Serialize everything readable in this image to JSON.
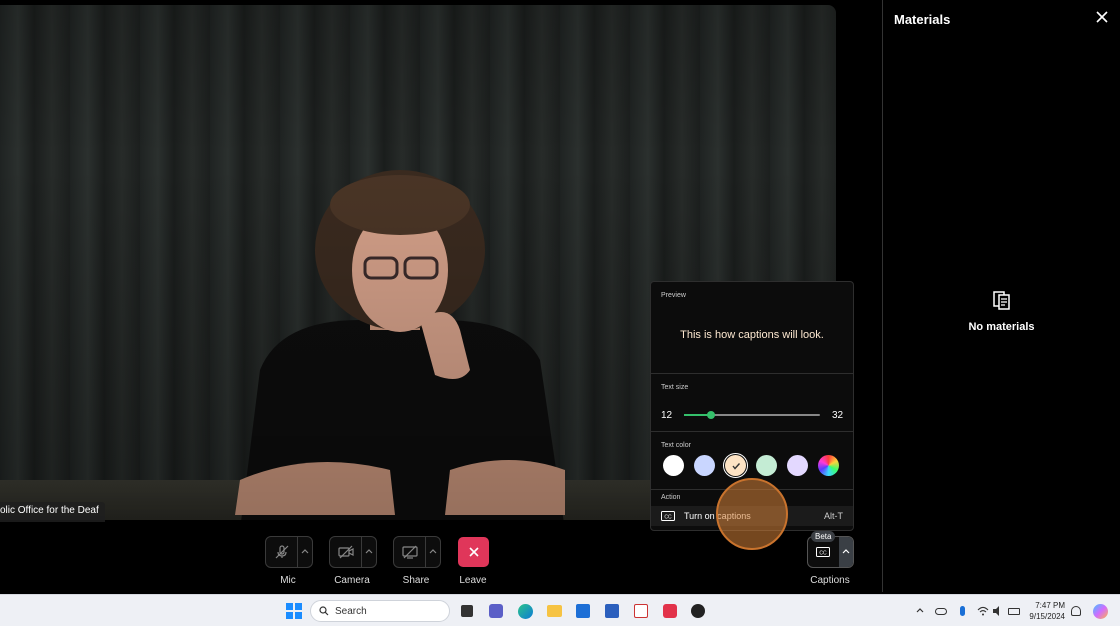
{
  "video": {
    "participant_name": "olic Office for the Deaf"
  },
  "materials": {
    "title": "Materials",
    "empty_label": "No materials"
  },
  "toolbar": {
    "mic_label": "Mic",
    "camera_label": "Camera",
    "share_label": "Share",
    "leave_label": "Leave",
    "captions_label": "Captions",
    "beta_badge": "Beta",
    "leave_color": "#e0365a"
  },
  "captions_popup": {
    "preview_label": "Preview",
    "preview_text": "This is how captions will look.",
    "text_size_label": "Text size",
    "size_min": "12",
    "size_max": "32",
    "size_value_fraction": 0.2,
    "text_color_label": "Text color",
    "colors": [
      "#ffffff",
      "#c9d6ff",
      "#fde3c4",
      "#c4ecd4",
      "#e3d8ff",
      "rainbow"
    ],
    "selected_color_index": 2,
    "action_label": "Action",
    "action_text": "Turn on captions",
    "action_shortcut": "Alt-T"
  },
  "taskbar": {
    "search_placeholder": "Search",
    "time": "7:47 PM",
    "date": "9/15/2024",
    "icons": [
      "windows-start-icon",
      "search-icon",
      "task-view-icon",
      "teams-icon",
      "edge-icon",
      "file-explorer-icon",
      "store-icon",
      "word-icon",
      "news-icon",
      "app-icon",
      "zoom-like-icon"
    ]
  }
}
